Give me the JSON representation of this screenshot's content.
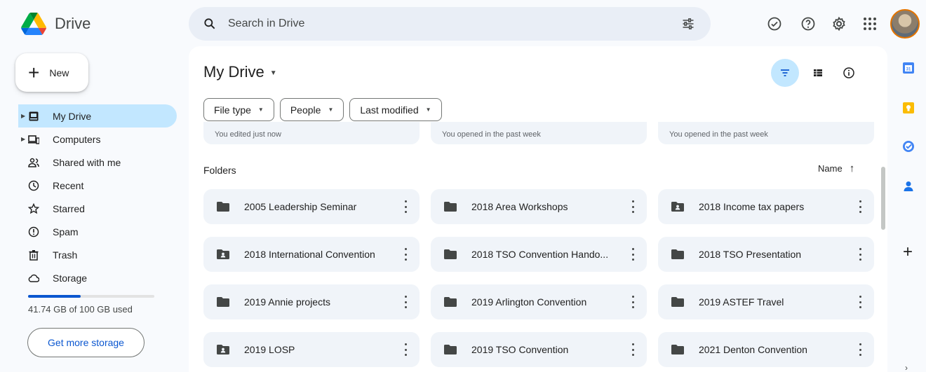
{
  "app": {
    "name": "Drive"
  },
  "search": {
    "placeholder": "Search in Drive"
  },
  "header_icons": [
    "offline-ready-icon",
    "help-icon",
    "settings-icon",
    "apps-grid-icon"
  ],
  "new_button": {
    "label": "New"
  },
  "sidebar": {
    "items": [
      {
        "label": "My Drive",
        "icon": "my-drive-icon",
        "active": true,
        "expandable": true
      },
      {
        "label": "Computers",
        "icon": "computers-icon",
        "active": false,
        "expandable": true
      },
      {
        "label": "Shared with me",
        "icon": "shared-icon",
        "active": false,
        "expandable": false
      },
      {
        "label": "Recent",
        "icon": "clock-icon",
        "active": false,
        "expandable": false
      },
      {
        "label": "Starred",
        "icon": "star-icon",
        "active": false,
        "expandable": false
      },
      {
        "label": "Spam",
        "icon": "spam-icon",
        "active": false,
        "expandable": false
      },
      {
        "label": "Trash",
        "icon": "trash-icon",
        "active": false,
        "expandable": false
      },
      {
        "label": "Storage",
        "icon": "cloud-icon",
        "active": false,
        "expandable": false
      }
    ],
    "storage": {
      "used_text": "41.74 GB of 100 GB used",
      "used_fraction": 0.4174,
      "get_more_label": "Get more storage"
    }
  },
  "main": {
    "title": "My Drive",
    "filters": [
      "File type",
      "People",
      "Last modified"
    ],
    "suggested_subtitles": [
      "You edited just now",
      "You opened in the past week",
      "You opened in the past week"
    ],
    "folders_label": "Folders",
    "sort_label": "Name",
    "folders": [
      {
        "name": "2005 Leadership Seminar",
        "shared": false
      },
      {
        "name": "2018 Area Workshops",
        "shared": false
      },
      {
        "name": "2018 Income tax papers",
        "shared": true
      },
      {
        "name": "2018 International Convention",
        "shared": true
      },
      {
        "name": "2018 TSO Convention Hando...",
        "shared": false
      },
      {
        "name": "2018 TSO Presentation",
        "shared": false
      },
      {
        "name": "2019 Annie projects",
        "shared": false
      },
      {
        "name": "2019 Arlington Convention",
        "shared": false
      },
      {
        "name": "2019 ASTEF Travel",
        "shared": false
      },
      {
        "name": "2019 LOSP",
        "shared": true
      },
      {
        "name": "2019 TSO Convention",
        "shared": false
      },
      {
        "name": "2021 Denton Convention",
        "shared": false
      }
    ]
  },
  "colors": {
    "accent": "#0b57d0",
    "active_bg": "#c2e7ff",
    "card_bg": "#f0f4f9",
    "page_bg": "#f8fafd"
  }
}
